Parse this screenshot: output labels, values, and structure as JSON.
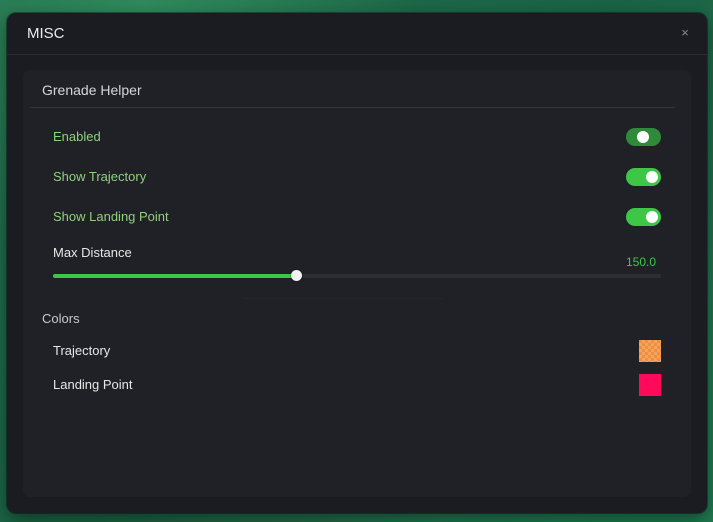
{
  "window": {
    "title": "MISC",
    "close_label": "×"
  },
  "grenade_helper": {
    "section_title": "Grenade Helper",
    "toggles": [
      {
        "label": "Enabled",
        "on": true
      },
      {
        "label": "Show Trajectory",
        "on": true
      },
      {
        "label": "Show Landing Point",
        "on": true
      }
    ],
    "max_distance": {
      "label": "Max Distance",
      "value": "150.0",
      "fraction": 0.4
    }
  },
  "colors": {
    "section_title": "Colors",
    "items": [
      {
        "label": "Trajectory",
        "color": "#f08f3c"
      },
      {
        "label": "Landing Point",
        "color": "#ff0a5a"
      }
    ]
  },
  "theme": {
    "accent": "#3cc747",
    "label_green": "#8ed17c"
  }
}
